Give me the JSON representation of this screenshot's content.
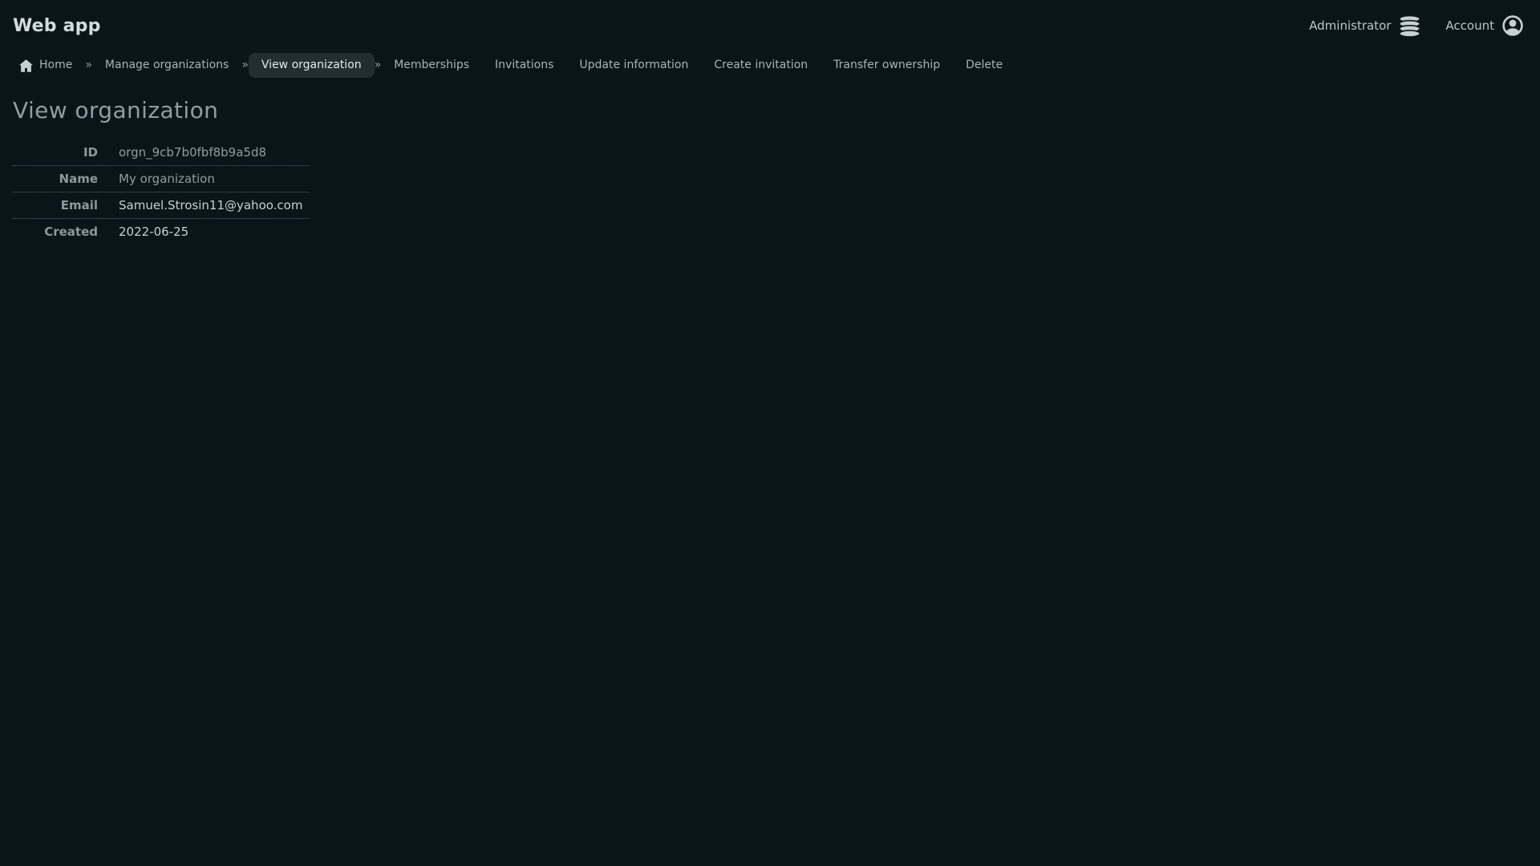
{
  "app": {
    "title": "Web app"
  },
  "topbar": {
    "administrator_label": "Administrator",
    "account_label": "Account",
    "icons": {
      "administrator": "database-icon",
      "account": "user-circle-icon"
    }
  },
  "nav": {
    "separator": "»",
    "items": [
      {
        "label": "Home",
        "icon": "home-icon",
        "active": false,
        "separator_after": true
      },
      {
        "label": "Manage organizations",
        "active": false,
        "separator_after": true
      },
      {
        "label": "View organization",
        "active": true,
        "separator_after": true
      },
      {
        "label": "Memberships",
        "active": false,
        "separator_after": false
      },
      {
        "label": "Invitations",
        "active": false,
        "separator_after": false
      },
      {
        "label": "Update information",
        "active": false,
        "separator_after": false
      },
      {
        "label": "Create invitation",
        "active": false,
        "separator_after": false
      },
      {
        "label": "Transfer ownership",
        "active": false,
        "separator_after": false
      },
      {
        "label": "Delete",
        "active": false,
        "separator_after": false
      }
    ]
  },
  "page": {
    "title": "View organization"
  },
  "details": {
    "rows": [
      {
        "label": "ID",
        "value": "orgn_9cb7b0fbf8b9a5d8",
        "muted": true
      },
      {
        "label": "Name",
        "value": "My organization",
        "muted": true
      },
      {
        "label": "Email",
        "value": "Samuel.Strosin11@yahoo.com",
        "muted": false
      },
      {
        "label": "Created",
        "value": "2022-06-25",
        "muted": false
      }
    ]
  },
  "colors": {
    "background": "#0a1519",
    "active_pill_background": "#212f31",
    "nav_text": "#a9b4b8",
    "active_pill_text": "#e4ebed",
    "heading_text": "#929da2",
    "label_text": "#8d989d",
    "muted_value_text": "#929da1",
    "value_text": "#c7d1d5",
    "divider_dotted": "#56676c",
    "icon": "#c6d0d3"
  }
}
